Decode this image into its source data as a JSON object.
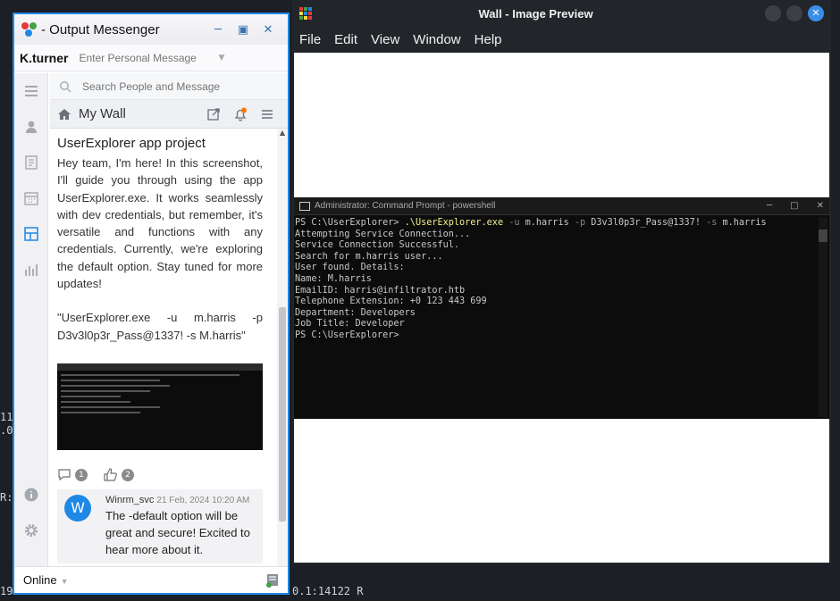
{
  "background_terminal": {
    "line1": "11",
    "line2": ".0",
    "line3": "R:",
    "bottom_left": "19",
    "bottom_right": "0.1:14122 R"
  },
  "messenger": {
    "window_title": "- Output Messenger",
    "username": "K.turner",
    "personal_message_placeholder": "Enter Personal Message",
    "search_placeholder": "Search People and Message",
    "wall_title": "My Wall",
    "post": {
      "title": "UserExplorer app project",
      "body": "Hey team, I'm here! In this screenshot, I'll guide you through using the app UserExplorer.exe. It works seamlessly with dev credentials, but remember, it's versatile and functions with any credentials. Currently, we're exploring the default option. Stay tuned for more updates!",
      "command": "\"UserExplorer.exe -u m.harris -p D3v3l0p3r_Pass@1337! -s M.harris\"",
      "comment_count": "1",
      "like_count": "2"
    },
    "comment": {
      "avatar_letter": "W",
      "author": "Winrm_svc",
      "date": "21 Feb, 2024 10:20 AM",
      "text": "The -default option will be great and secure! Excited to hear more about it."
    },
    "status": "Online",
    "colors": {
      "accent": "#1e88e5",
      "notify_dot": "#f57c00"
    },
    "icons": [
      "menu-icon",
      "contacts-icon",
      "notes-icon",
      "calendar-icon",
      "wall-icon",
      "stats-icon",
      "info-icon",
      "settings-icon",
      "home-icon",
      "external-link-icon",
      "bell-icon",
      "list-icon",
      "search-icon",
      "comment-icon",
      "like-icon"
    ]
  },
  "preview": {
    "window_title": "Wall - Image Preview",
    "menu": [
      "File",
      "Edit",
      "View",
      "Window",
      "Help"
    ],
    "cmd": {
      "title": "Administrator: Command Prompt - powershell",
      "prompt": "PS C:\\UserExplorer> ",
      "exe": ".\\UserExplorer.exe",
      "args": [
        {
          "flag": "-u",
          "value": "m.harris"
        },
        {
          "flag": "-p",
          "value": "D3v3l0p3r_Pass@1337!"
        },
        {
          "flag": "-s",
          "value": "m.harris"
        }
      ],
      "output": [
        "Attempting Service Connection...",
        "Service Connection Successful.",
        "Search for m.harris user...",
        "User found. Details:",
        "Name: M.harris",
        "EmailID: harris@infiltrator.htb",
        "Telephone Extension: +0 123 443 699",
        "Department: Developers",
        "Job Title: Developer",
        "PS C:\\UserExplorer>"
      ]
    }
  }
}
